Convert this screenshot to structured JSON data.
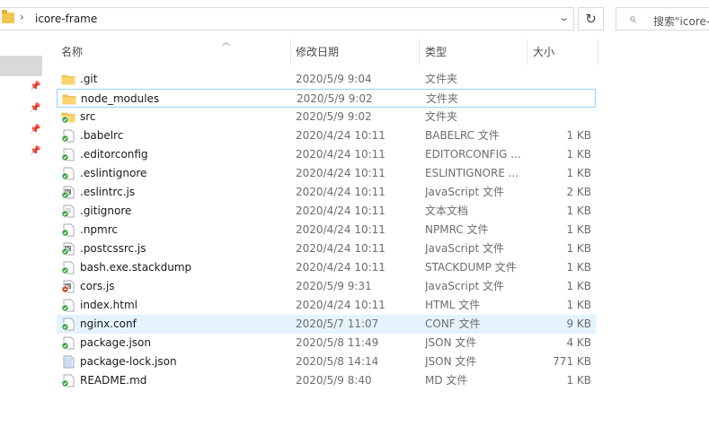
{
  "address": {
    "path": "icore-frame",
    "separator": "›"
  },
  "search": {
    "placeholder": "搜索\"icore-"
  },
  "columns": {
    "name": "名称",
    "date": "修改日期",
    "type": "类型",
    "size": "大小"
  },
  "files": [
    {
      "name": ".git",
      "date": "2020/5/9 9:04",
      "type": "文件夹",
      "size": "",
      "icon": "folder-icon"
    },
    {
      "name": "node_modules",
      "date": "2020/5/9 9:02",
      "type": "文件夹",
      "size": "",
      "icon": "folder-icon"
    },
    {
      "name": "src",
      "date": "2020/5/9 9:02",
      "type": "文件夹",
      "size": "",
      "icon": "folder-synced-icon"
    },
    {
      "name": ".babelrc",
      "date": "2020/4/24 10:11",
      "type": "BABELRC 文件",
      "size": "1 KB",
      "icon": "file-synced-icon"
    },
    {
      "name": ".editorconfig",
      "date": "2020/4/24 10:11",
      "type": "EDITORCONFIG ...",
      "size": "1 KB",
      "icon": "file-synced-icon"
    },
    {
      "name": ".eslintignore",
      "date": "2020/4/24 10:11",
      "type": "ESLINTIGNORE ...",
      "size": "1 KB",
      "icon": "file-synced-icon"
    },
    {
      "name": ".eslintrc.js",
      "date": "2020/4/24 10:11",
      "type": "JavaScript 文件",
      "size": "2 KB",
      "icon": "js-file-synced-icon"
    },
    {
      "name": ".gitignore",
      "date": "2020/4/24 10:11",
      "type": "文本文档",
      "size": "1 KB",
      "icon": "text-file-synced-icon"
    },
    {
      "name": ".npmrc",
      "date": "2020/4/24 10:11",
      "type": "NPMRC 文件",
      "size": "1 KB",
      "icon": "file-synced-icon"
    },
    {
      "name": ".postcssrc.js",
      "date": "2020/4/24 10:11",
      "type": "JavaScript 文件",
      "size": "1 KB",
      "icon": "js-file-synced-icon"
    },
    {
      "name": "bash.exe.stackdump",
      "date": "2020/4/24 10:11",
      "type": "STACKDUMP 文件",
      "size": "1 KB",
      "icon": "file-synced-icon"
    },
    {
      "name": "cors.js",
      "date": "2020/5/9 9:31",
      "type": "JavaScript 文件",
      "size": "1 KB",
      "icon": "js-file-modified-icon"
    },
    {
      "name": "index.html",
      "date": "2020/4/24 10:11",
      "type": "HTML 文件",
      "size": "1 KB",
      "icon": "file-synced-icon"
    },
    {
      "name": "nginx.conf",
      "date": "2020/5/7 11:07",
      "type": "CONF 文件",
      "size": "9 KB",
      "icon": "file-synced-icon"
    },
    {
      "name": "package.json",
      "date": "2020/5/8 11:49",
      "type": "JSON 文件",
      "size": "4 KB",
      "icon": "file-synced-icon"
    },
    {
      "name": "package-lock.json",
      "date": "2020/5/8 14:14",
      "type": "JSON 文件",
      "size": "771 KB",
      "icon": "file-icon"
    },
    {
      "name": "README.md",
      "date": "2020/5/9 8:40",
      "type": "MD 文件",
      "size": "1 KB",
      "icon": "file-synced-icon"
    }
  ],
  "colors": {
    "folder": "#f5c64f",
    "sync_ok": "#2f9e3a",
    "modified": "#d9412e",
    "hover_row": "#e5f3ff",
    "focus_border": "#99d1ff"
  }
}
